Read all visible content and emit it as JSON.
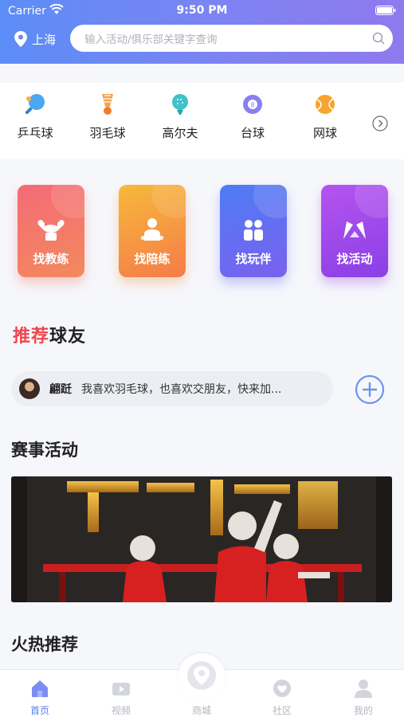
{
  "status_bar": {
    "carrier": "Carrier",
    "time": "9:50 PM"
  },
  "header": {
    "city": "上海",
    "search_placeholder": "输入活动/俱乐部关键字查询"
  },
  "categories": [
    {
      "label": "乒乓球",
      "icon": "ping-pong-icon"
    },
    {
      "label": "羽毛球",
      "icon": "shuttlecock-icon"
    },
    {
      "label": "高尔夫",
      "icon": "golf-icon"
    },
    {
      "label": "台球",
      "icon": "billiards-icon"
    },
    {
      "label": "网球",
      "icon": "tennis-icon"
    }
  ],
  "tiles": [
    {
      "label": "找教练",
      "icon": "muscle-icon",
      "color": "#f56a78"
    },
    {
      "label": "找陪练",
      "icon": "person-icon",
      "color": "#f6b93a"
    },
    {
      "label": "找玩伴",
      "icon": "people-icon",
      "color": "#4e7cf5"
    },
    {
      "label": "找活动",
      "icon": "flags-icon",
      "color": "#b554ef"
    }
  ],
  "recommend": {
    "title_accent": "推荐",
    "title_rest": "球友",
    "friend_name": "翩跹",
    "friend_message": "我喜欢羽毛球，也喜欢交朋友，快来加..."
  },
  "events": {
    "title": "赛事活动"
  },
  "hot": {
    "title": "火热推荐"
  },
  "tabbar": {
    "home": "首页",
    "video": "视频",
    "mall": "商城",
    "community": "社区",
    "mine": "我的",
    "active_color": "#5b7cf5"
  }
}
